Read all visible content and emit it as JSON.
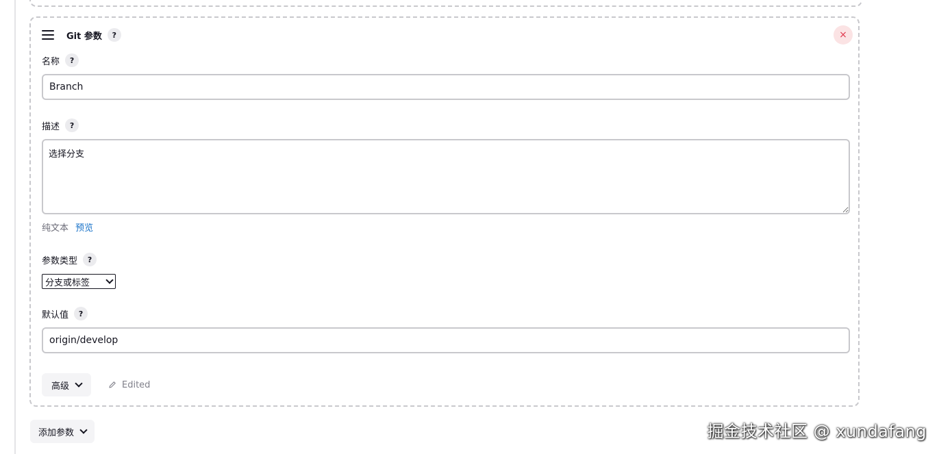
{
  "card": {
    "title": "Git 参数",
    "close_label": "×"
  },
  "help_glyph": "?",
  "name_field": {
    "label": "名称",
    "value": "Branch"
  },
  "description_field": {
    "label": "描述",
    "value": "选择分支",
    "format_label": "纯文本",
    "preview_label": "预览"
  },
  "param_type": {
    "label": "参数类型",
    "selected": "分支或标签"
  },
  "default_value": {
    "label": "默认值",
    "value": "origin/develop"
  },
  "advanced_button": {
    "label": "高级"
  },
  "edited_label": "Edited",
  "add_param_button": {
    "label": "添加参数"
  },
  "watermark": "掘金技术社区 @ xundafang",
  "colors": {
    "border_dashed": "#c8c8cc",
    "link": "#1a73c9",
    "close_bg": "#fbe3e4",
    "close_fg": "#e0364c",
    "help_bg": "#ebebee"
  },
  "icons": {
    "drag": "drag-handle-icon",
    "help": "help-icon",
    "close": "close-icon",
    "chevron": "chevron-down-icon",
    "pencil": "pencil-icon"
  }
}
